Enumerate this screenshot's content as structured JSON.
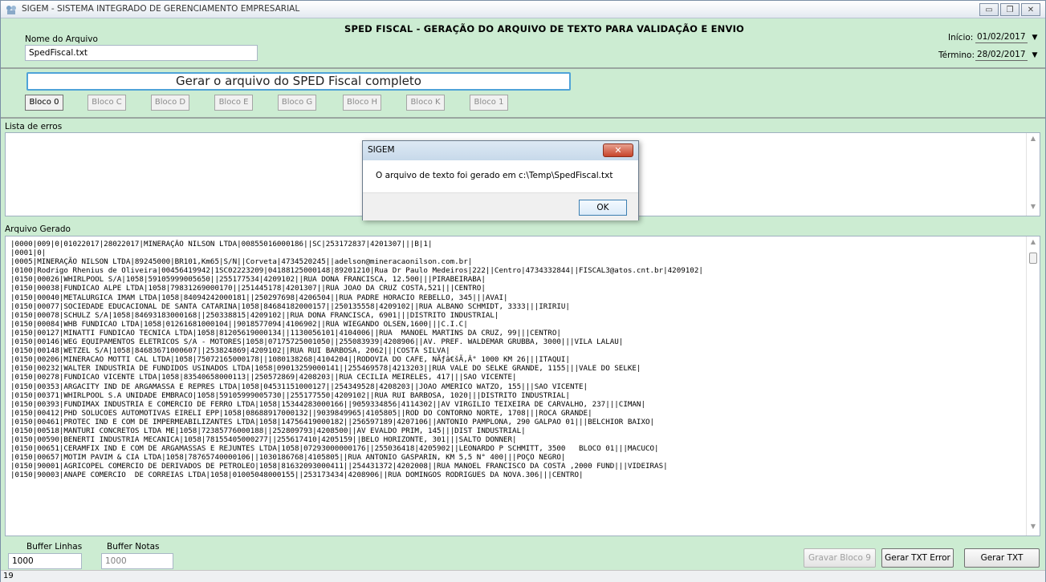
{
  "window": {
    "title": "SIGEM - SISTEMA INTEGRADO DE GERENCIAMENTO EMPRESARIAL",
    "minimize_symbol": "▭",
    "restore_symbol": "❐",
    "close_symbol": "✕"
  },
  "form": {
    "title": "SPED FISCAL - GERAÇÃO DO ARQUIVO DE TEXTO PARA VALIDAÇÃO E ENVIO",
    "filename_label": "Nome do Arquivo",
    "filename_value": "SpedFiscal.txt",
    "inicio_label": "Início:",
    "inicio_value": "01/02/2017",
    "termino_label": "Término:",
    "termino_value": "28/02/2017",
    "dropdown_arrow": "▼"
  },
  "actions": {
    "generate_full": "Gerar o arquivo do SPED Fiscal completo",
    "blocos": [
      "Bloco 0",
      "Bloco C",
      "Bloco D",
      "Bloco E",
      "Bloco G",
      "Bloco H",
      "Bloco K",
      "Bloco 1"
    ]
  },
  "errors": {
    "label": "Lista de erros"
  },
  "output": {
    "label": "Arquivo Gerado",
    "lines": [
      "|0000|009|0|01022017|28022017|MINERAÇÃO NILSON LTDA|00855016000186||SC|253172837|4201307|||B|1|",
      "|0001|0|",
      "|0005|MINERAÇÃO NILSON LTDA|89245000|BR101,Km65|S/N||Corveta|4734520245||adelson@mineracaonilson.com.br|",
      "|0100|Rodrigo Rhenius de Oliveira|00456419942|1SC02223209|04188125000148|89201210|Rua Dr Paulo Medeiros|222||Centro|4734332844||FISCAL3@atos.cnt.br|4209102|",
      "|0150|00026|WHIRLPOOL S/A|1058|59105999005650||255177534|4209102||RUA DONA FRANCISCA, 12.500|||PIRABEIRABA|",
      "|0150|00038|FUNDICAO ALPE LTDA|1058|79831269000170||251445178|4201307||RUA JOAO DA CRUZ COSTA,521|||CENTRO|",
      "|0150|00040|METALURGICA IMAM LTDA|1058|84094242000181||250297698|4206504||RUA PADRE HORACIO REBELLO, 345|||AVAI|",
      "|0150|00077|SOCIEDADE EDUCACIONAL DE SANTA CATARINA|1058|84684182000157||250135558|4209102||RUA ALBANO SCHMIDT, 3333|||IRIRIU|",
      "|0150|00078|SCHULZ S/A|1058|84693183000168||250338815|4209102||RUA DONA FRANCISCA, 6901|||DISTRITO INDUSTRIAL|",
      "|0150|00084|WHB FUNDICAO LTDA|1058|01261681000104||9018577094|4106902||RUA WIEGANDO OLSEN,1600|||C.I.C|",
      "|0150|00127|MINATTI FUNDICAO TECNICA LTDA|1058|81205619000134||1130056101|4104006||RUA  MANOEL MARTINS DA CRUZ, 99|||CENTRO|",
      "|0150|00146|WEG EQUIPAMENTOS ELETRICOS S/A - MOTORES|1058|07175725001050||255083939|4208906||AV. PREF. WALDEMAR GRUBBA, 3000|||VILA LALAU|",
      "|0150|00148|WETZEL S/A|1058|84683671000607||253824869|4209102||RUA RUI BARBOSA, 2062|||COSTA SILVA|",
      "|0150|00206|MINERACAO MOTTI CAL LTDA|1058|75072165000178||1080138268|4104204||RODOVIA DO CAFE, NÃƒâ€šÃ‚Â° 1000 KM 26|||ITAQUI|",
      "|0150|00232|WALTER INDUSTRIA DE FUNDIDOS USINADOS LTDA|1058|09013259000141||255469578|4213203||RUA VALE DO SELKE GRANDE, 1155|||VALE DO SELKE|",
      "|0150|00278|FUNDICAO VICENTE LTDA|1058|83540658000113||250572869|4208203||RUA CECILIA MEIRELES, 417|||SAO VICENTE|",
      "|0150|00353|ARGACITY IND DE ARGAMASSA E REPRES LTDA|1058|04531151000127||254349528|4208203||JOAO AMERICO WATZO, 155|||SAO VICENTE|",
      "|0150|00371|WHIRLPOOL S.A UNIDADE EMBRACO|1058|59105999005730||255177550|4209102||RUA RUI BARBOSA, 1020|||DISTRITO INDUSTRIAL|",
      "|0150|00393|FUNDIMAX INDUSTRIA E COMERCIO DE FERRO LTDA|1058|15344283000166||9059334856|4114302||AV VIRGILIO TEIXEIRA DE CARVALHO, 237|||CIMAN|",
      "|0150|00412|PHD SOLUCOES AUTOMOTIVAS EIRELI EPP|1058|08688917000132||9039849965|4105805||ROD DO CONTORNO NORTE, 1708|||ROCA GRANDE|",
      "|0150|00461|PROTEC IND E COM DE IMPERMEABILIZANTES LTDA|1058|14756419000182||256597189|4207106||ANTONIO PAMPLONA, 290 GALPAO 01|||BELCHIOR BAIXO|",
      "|0150|00518|MANTURI CONCRETOS LTDA ME|1058|72385776000188||252809793|4208500||AV EVALDO PRIM, 145|||DIST INDUSTRIAL|",
      "|0150|00590|BENERTI INDUSTRIA MECANICA|1058|78155405000277||255617410|4205159||BELO HORIZONTE, 301|||SALTO DONNER|",
      "|0150|00651|CERAMFIX IND E COM DE ARGAMASSAS E REJUNTES LTDA|1058|07293000000176||255036418|4205902||LEONARDO P SCHMITT, 3500   BLOCO 01|||MACUCO|",
      "|0150|00657|MOTIM PAVIM & CIA LTDA|1058|78765740000106||1030186768|4105805||RUA ANTONIO GASPARIN, KM 5,5 N° 400|||POÇO NEGRO|",
      "|0150|90001|AGRICOPEL COMERCIO DE DERIVADOS DE PETROLEO|1058|81632093000411||254431372|4202008||RUA MANOEL FRANCISCO DA COSTA ,2000 FUND|||VIDEIRAS|",
      "|0150|90003|ANAPE COMERCIO  DE CORREIAS LTDA|1058|01005048000155||253173434|4208906||RUA DOMINGOS RODRIGUES DA NOVA.306|||CENTRO|"
    ]
  },
  "buffers": {
    "linhas_label": "Buffer Linhas",
    "linhas_value": "1000",
    "notas_label": "Buffer Notas",
    "notas_value": "1000"
  },
  "bottom_buttons": {
    "gravar_bloco9": "Gravar Bloco 9",
    "gerar_txt_error": "Gerar TXT Error",
    "gerar_txt": "Gerar TXT"
  },
  "status": {
    "count": "19"
  },
  "dialog": {
    "title": "SIGEM",
    "message": "O arquivo de texto foi gerado em c:\\Temp\\SpedFiscal.txt",
    "ok_label": "OK",
    "close_symbol": "✕"
  }
}
